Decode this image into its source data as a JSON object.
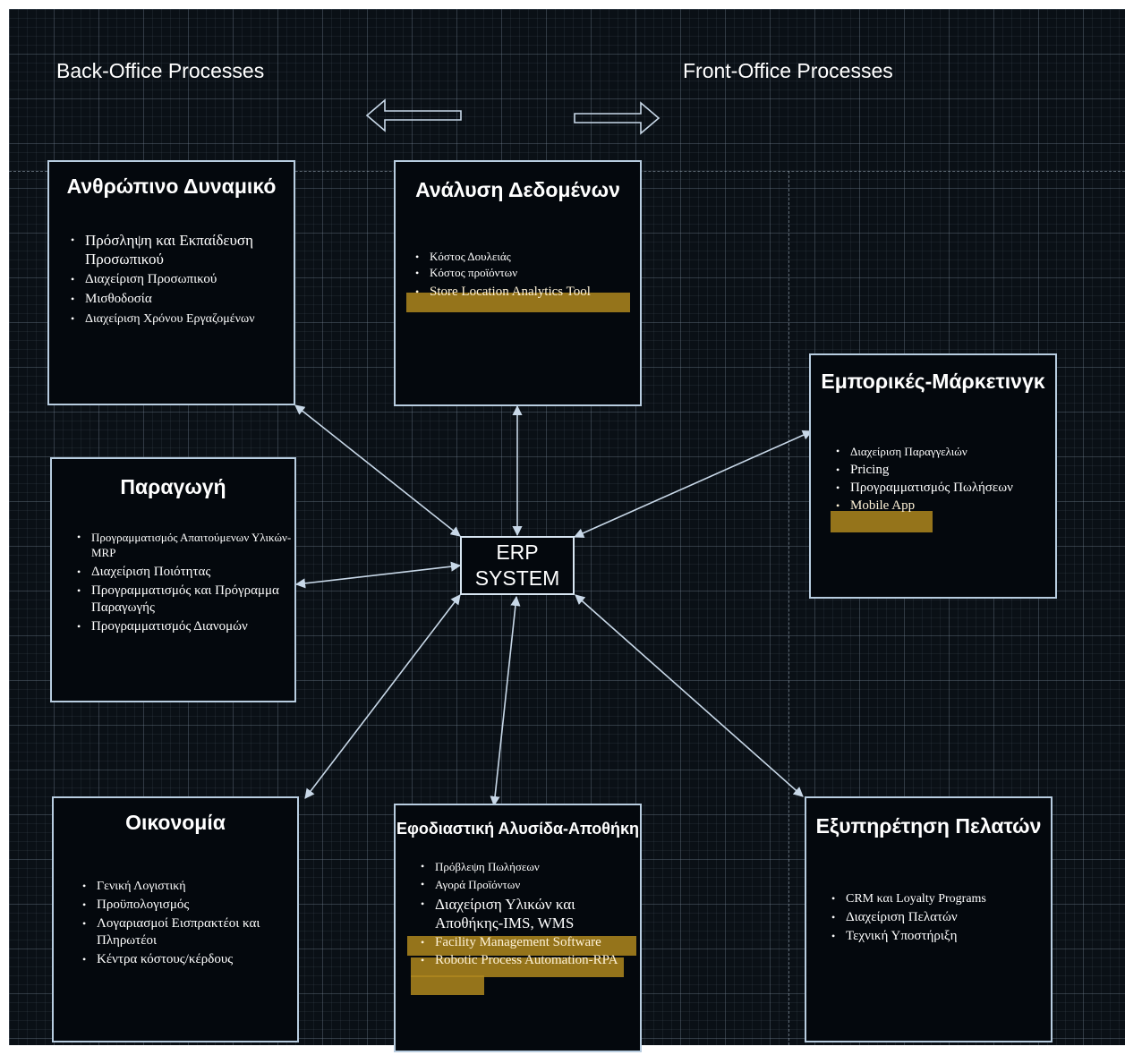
{
  "headings": {
    "back_office": "Back-Office Processes",
    "front_office": "Front-Office Processes"
  },
  "center": {
    "line1": "ERP",
    "line2": "SYSTEM"
  },
  "boxes": {
    "hr": {
      "title": "Ανθρώπινο Δυναμικό",
      "items": [
        "Πρόσληψη και Εκπαίδευση Προσωπικού",
        "Διαχείριση Προσωπικού",
        "Μισθοδοσία",
        "Διαχείριση Χρόνου Εργαζομένων"
      ]
    },
    "data": {
      "title": "Ανάλυση Δεδομένων",
      "items": [
        "Κόστος Δουλειάς",
        "Κόστος προϊόντων",
        "Store Location Analytics Tool"
      ]
    },
    "marketing": {
      "title": "Εμπορικές-Μάρκετινγκ",
      "items": [
        "Διαχείριση Παραγγελιών",
        "Pricing",
        "Προγραμματισμός Πωλήσεων",
        "Mobile App"
      ]
    },
    "production": {
      "title": "Παραγωγή",
      "items": [
        "Προγραμματισμός Απαιτούμενων Υλικών-MRP",
        "Διαχείριση Ποιότητας",
        "Προγραμματισμός και Πρόγραμμα Παραγωγής",
        "Προγραμματισμός Διανομών"
      ]
    },
    "finance": {
      "title": "Οικονομία",
      "items": [
        "Γενική Λογιστική",
        "Προϋπολογισμός",
        "Λογαριασμοί Εισπρακτέοι και Πληρωτέοι",
        "Κέντρα κόστους/κέρδους"
      ]
    },
    "logistics": {
      "title": "Εφοδιαστική Αλυσίδα-Αποθήκη",
      "items": [
        "Πρόβλεψη Πωλήσεων",
        "Αγορά Προϊόντων",
        "Διαχείριση Υλικών και Αποθήκης-IMS, WMS",
        "Facility Management Software",
        "Robotic Process Automation-RPA"
      ]
    },
    "service": {
      "title": "Εξυπηρέτηση Πελατών",
      "items": [
        "CRM και Loyalty Programs",
        "Διαχείριση Πελατών",
        "Τεχνική Υποστήριξη"
      ]
    }
  },
  "colors": {
    "highlight": "#af871e",
    "border": "#b8cde0",
    "background": "#0a1016"
  }
}
